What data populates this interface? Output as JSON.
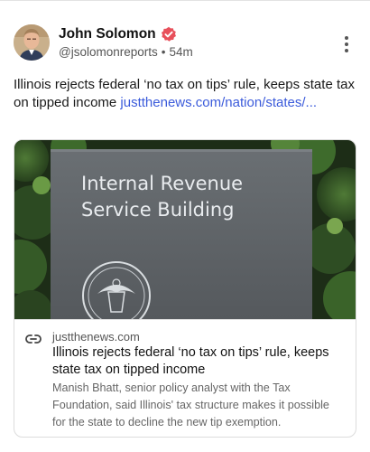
{
  "post": {
    "author": {
      "name": "John Solomon",
      "handle": "@jsolomonreports",
      "time": "54m",
      "separator": "•"
    },
    "text": "Illinois rejects federal ‘no tax on tips’ rule, keeps state tax on tipped income ",
    "link_text": "justthenews.com/nation/states/...",
    "card": {
      "image_sign_line1": "Internal Revenue",
      "image_sign_line2": "Service Building",
      "domain": "justthenews.com",
      "title": "Illinois rejects federal ‘no tax on tips’ rule, keeps state tax on tipped income",
      "description": "Manish Bhatt, senior policy analyst with the Tax Foundation, said Illinois' tax structure makes it possible for the state to decline the new tip exemption."
    }
  },
  "colors": {
    "verified": "#e8505b",
    "link": "#3b5bdb"
  },
  "icons": {
    "verified": "verified-badge-icon",
    "more": "more-vertical-icon",
    "link": "link-icon"
  }
}
